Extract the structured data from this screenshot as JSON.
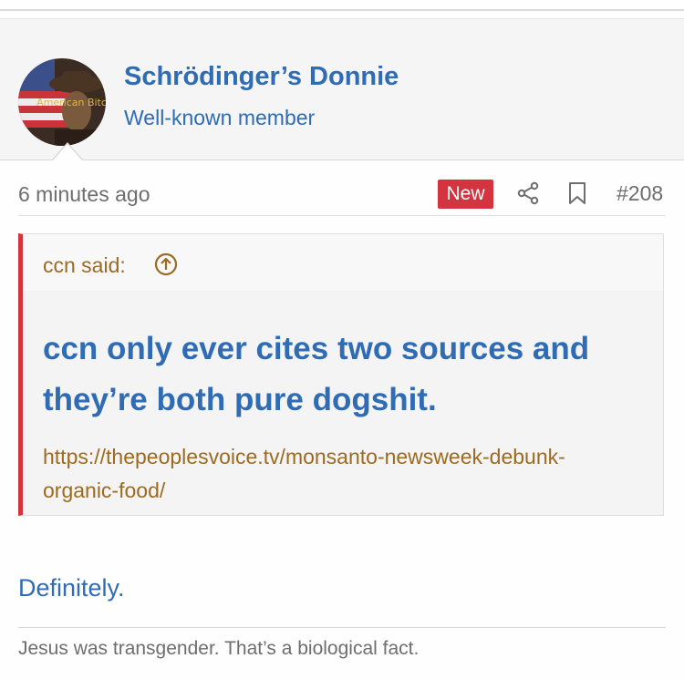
{
  "post": {
    "author": {
      "name": "Schrödinger’s Donnie",
      "title": "Well-known member",
      "avatar_caption": "American Bitch"
    },
    "timestamp": "6 minutes ago",
    "badge": "New",
    "post_number": "#208",
    "quote": {
      "author": "ccn said:",
      "title": "ccn only ever cites two sources and they’re both pure dogshit.",
      "link": "https://thepeoplesvoice.tv/monsanto-newsweek-debunk-organic-food/"
    },
    "body": "Definitely.",
    "signature": "Jesus was transgender. That’s a biological fact."
  },
  "colors": {
    "accent_blue": "#2f6cb3",
    "quote_brown": "#9b6b22",
    "badge_red": "#d4343f"
  },
  "icons": [
    "share-icon",
    "bookmark-icon",
    "arrow-up-circle-icon"
  ]
}
